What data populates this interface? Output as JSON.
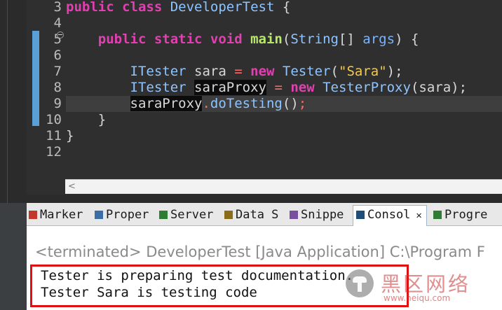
{
  "editor": {
    "line_numbers": [
      "3",
      "4",
      "5",
      "6",
      "7",
      "8",
      "9",
      "10",
      "11",
      "12"
    ],
    "lines": [
      [
        {
          "t": "public class ",
          "c": "kw"
        },
        {
          "t": "DeveloperTest",
          "c": "cls"
        },
        {
          "t": " {",
          "c": "plain"
        }
      ],
      [],
      [
        {
          "t": "    public static void ",
          "c": "kw"
        },
        {
          "t": "main",
          "c": "method"
        },
        {
          "t": "(",
          "c": "plain"
        },
        {
          "t": "String",
          "c": "cls"
        },
        {
          "t": "[] ",
          "c": "plain"
        },
        {
          "t": "args",
          "c": "var"
        },
        {
          "t": ") {",
          "c": "plain"
        }
      ],
      [],
      [
        {
          "t": "        ",
          "c": "plain"
        },
        {
          "t": "ITester",
          "c": "cls"
        },
        {
          "t": " ",
          "c": "plain"
        },
        {
          "t": "sara",
          "c": "plain"
        },
        {
          "t": " = ",
          "c": "op"
        },
        {
          "t": "new ",
          "c": "kw"
        },
        {
          "t": "Tester",
          "c": "cls"
        },
        {
          "t": "(",
          "c": "plain"
        },
        {
          "t": "\"Sara\"",
          "c": "str"
        },
        {
          "t": ");",
          "c": "plain"
        }
      ],
      [
        {
          "t": "        ",
          "c": "plain"
        },
        {
          "t": "ITester",
          "c": "cls"
        },
        {
          "t": " ",
          "c": "plain"
        },
        {
          "t": "saraProxy",
          "c": "plain hl"
        },
        {
          "t": " = ",
          "c": "op"
        },
        {
          "t": "new ",
          "c": "kw"
        },
        {
          "t": "TesterProxy",
          "c": "cls"
        },
        {
          "t": "(",
          "c": "plain"
        },
        {
          "t": "sara",
          "c": "plain"
        },
        {
          "t": ");",
          "c": "plain"
        }
      ],
      [
        {
          "t": "        ",
          "c": "plain"
        },
        {
          "t": "saraProxy",
          "c": "plain hl"
        },
        {
          "t": ".",
          "c": "op"
        },
        {
          "t": "doTesting",
          "c": "method2"
        },
        {
          "t": "()",
          "c": "plain"
        },
        {
          "t": ";",
          "c": "op"
        }
      ],
      [
        {
          "t": "    }",
          "c": "plain"
        }
      ],
      [
        {
          "t": "}",
          "c": "plain"
        }
      ],
      []
    ]
  },
  "tabs": [
    {
      "label": "Marker",
      "icon": "marker-icon",
      "color": "#c0392b"
    },
    {
      "label": "Proper",
      "icon": "properties-icon",
      "color": "#3a6ea5"
    },
    {
      "label": "Server",
      "icon": "server-icon",
      "color": "#2e7d32"
    },
    {
      "label": "Data S",
      "icon": "data-source-icon",
      "color": "#8a6d1a"
    },
    {
      "label": "Snippe",
      "icon": "snippets-icon",
      "color": "#7a4fa0"
    },
    {
      "label": "Consol",
      "icon": "console-icon",
      "color": "#1f4e79",
      "active": true
    },
    {
      "label": "Progre",
      "icon": "progress-icon",
      "color": "#2e7d32"
    }
  ],
  "console": {
    "terminated_text": "<terminated> DeveloperTest [Java Application] C:\\Program F",
    "output": [
      "Tester is preparing test documentation.",
      "Tester Sara is testing code"
    ]
  },
  "watermark": {
    "text": "黑区网络",
    "url": "www.heiqu.com"
  }
}
